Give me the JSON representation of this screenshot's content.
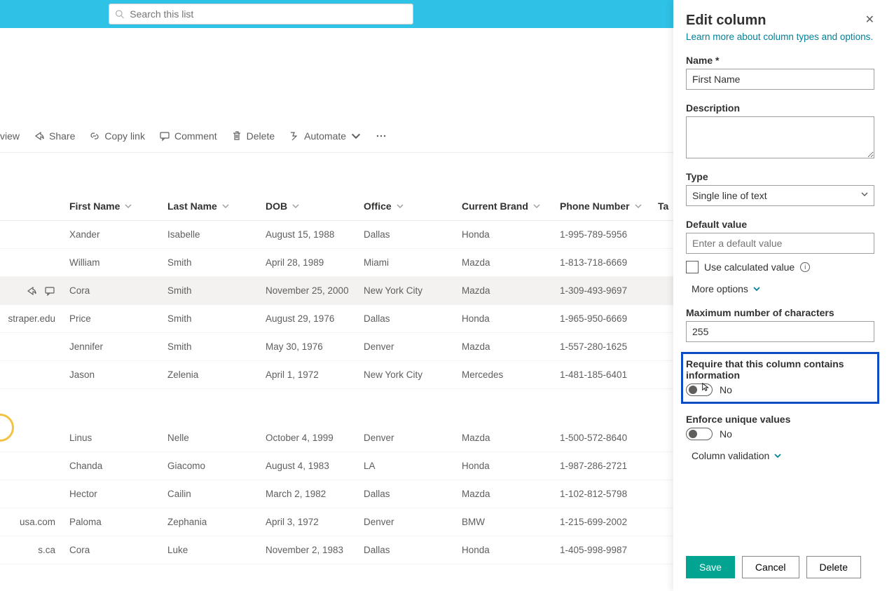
{
  "search": {
    "placeholder": "Search this list"
  },
  "cmd": {
    "view": "view",
    "share": "Share",
    "copy": "Copy link",
    "comment": "Comment",
    "delete": "Delete",
    "automate": "Automate"
  },
  "headers": {
    "first": "First Name",
    "last": "Last Name",
    "dob": "DOB",
    "office": "Office",
    "brand": "Current Brand",
    "phone": "Phone Number",
    "ta": "Ta"
  },
  "rows": [
    {
      "lead": "",
      "first": "Xander",
      "last": "Isabelle",
      "dob": "August 15, 1988",
      "office": "Dallas",
      "brand": "Honda",
      "phone": "1-995-789-5956"
    },
    {
      "lead": "",
      "first": "William",
      "last": "Smith",
      "dob": "April 28, 1989",
      "office": "Miami",
      "brand": "Mazda",
      "phone": "1-813-718-6669"
    },
    {
      "lead": "",
      "first": "Cora",
      "last": "Smith",
      "dob": "November 25, 2000",
      "office": "New York City",
      "brand": "Mazda",
      "phone": "1-309-493-9697",
      "hl": true
    },
    {
      "lead": "straper.edu",
      "first": "Price",
      "last": "Smith",
      "dob": "August 29, 1976",
      "office": "Dallas",
      "brand": "Honda",
      "phone": "1-965-950-6669"
    },
    {
      "lead": "",
      "first": "Jennifer",
      "last": "Smith",
      "dob": "May 30, 1976",
      "office": "Denver",
      "brand": "Mazda",
      "phone": "1-557-280-1625"
    },
    {
      "lead": "",
      "first": "Jason",
      "last": "Zelenia",
      "dob": "April 1, 1972",
      "office": "New York City",
      "brand": "Mercedes",
      "phone": "1-481-185-6401"
    }
  ],
  "rows2": [
    {
      "lead": "",
      "first": "Linus",
      "last": "Nelle",
      "dob": "October 4, 1999",
      "office": "Denver",
      "brand": "Mazda",
      "phone": "1-500-572-8640"
    },
    {
      "lead": "",
      "first": "Chanda",
      "last": "Giacomo",
      "dob": "August 4, 1983",
      "office": "LA",
      "brand": "Honda",
      "phone": "1-987-286-2721"
    },
    {
      "lead": "",
      "first": "Hector",
      "last": "Cailin",
      "dob": "March 2, 1982",
      "office": "Dallas",
      "brand": "Mazda",
      "phone": "1-102-812-5798"
    },
    {
      "lead": "usa.com",
      "first": "Paloma",
      "last": "Zephania",
      "dob": "April 3, 1972",
      "office": "Denver",
      "brand": "BMW",
      "phone": "1-215-699-2002"
    },
    {
      "lead": "s.ca",
      "first": "Cora",
      "last": "Luke",
      "dob": "November 2, 1983",
      "office": "Dallas",
      "brand": "Honda",
      "phone": "1-405-998-9987"
    }
  ],
  "panel": {
    "title": "Edit column",
    "link": "Learn more about column types and options.",
    "name_label": "Name *",
    "name_value": "First Name",
    "desc_label": "Description",
    "type_label": "Type",
    "type_value": "Single line of text",
    "default_label": "Default value",
    "default_placeholder": "Enter a default value",
    "use_calc": "Use calculated value",
    "more_options": "More options",
    "max_label": "Maximum number of characters",
    "max_value": "255",
    "require_label": "Require that this column contains information",
    "require_value": "No",
    "unique_label": "Enforce unique values",
    "unique_value": "No",
    "col_validation": "Column validation",
    "save": "Save",
    "cancel": "Cancel",
    "delete": "Delete"
  }
}
